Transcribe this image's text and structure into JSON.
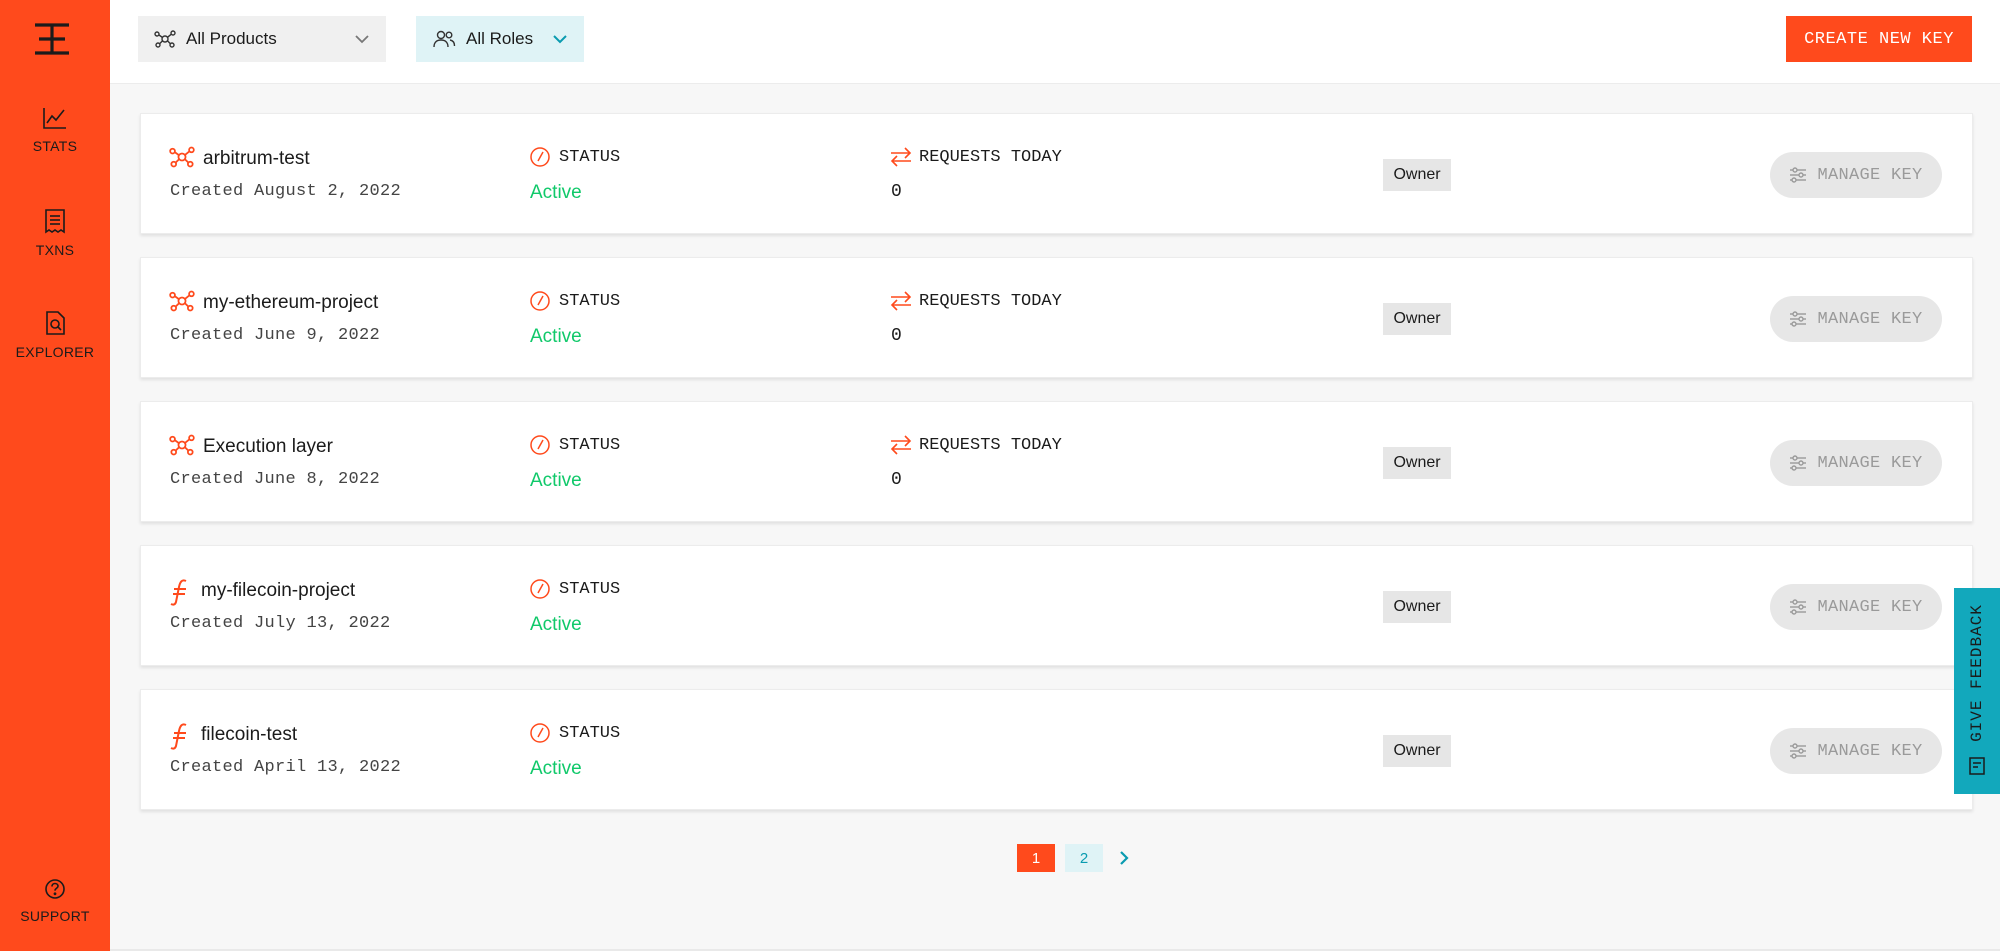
{
  "sidebar": {
    "logo": "logo-icon",
    "items": [
      {
        "label": "STATS",
        "icon": "chart-line-icon"
      },
      {
        "label": "TXNS",
        "icon": "receipt-icon"
      },
      {
        "label": "EXPLORER",
        "icon": "file-search-icon"
      }
    ],
    "support": {
      "label": "SUPPORT",
      "icon": "help-circle-icon"
    }
  },
  "topbar": {
    "products_filter": "All Products",
    "roles_filter": "All Roles",
    "create_button": "CREATE NEW KEY"
  },
  "columns": {
    "status_label": "STATUS",
    "requests_label": "REQUESTS TODAY",
    "manage_label": "MANAGE KEY"
  },
  "keys": [
    {
      "name": "arbitrum-test",
      "created": "Created August 2, 2022",
      "status": "Active",
      "requests": "0",
      "role": "Owner",
      "product_icon": "network-icon"
    },
    {
      "name": "my-ethereum-project",
      "created": "Created June 9, 2022",
      "status": "Active",
      "requests": "0",
      "role": "Owner",
      "product_icon": "network-icon"
    },
    {
      "name": "Execution layer",
      "created": "Created June 8, 2022",
      "status": "Active",
      "requests": "0",
      "role": "Owner",
      "product_icon": "network-icon"
    },
    {
      "name": "my-filecoin-project",
      "created": "Created July 13, 2022",
      "status": "Active",
      "requests": null,
      "role": "Owner",
      "product_icon": "filecoin-icon"
    },
    {
      "name": "filecoin-test",
      "created": "Created April 13, 2022",
      "status": "Active",
      "requests": null,
      "role": "Owner",
      "product_icon": "filecoin-icon"
    }
  ],
  "pagination": {
    "pages": [
      "1",
      "2"
    ],
    "current": "1"
  },
  "feedback": {
    "label": "GIVE FEEDBACK"
  },
  "colors": {
    "brand": "#ff4a1c",
    "active": "#10c96a",
    "accent": "#12a8bc"
  }
}
